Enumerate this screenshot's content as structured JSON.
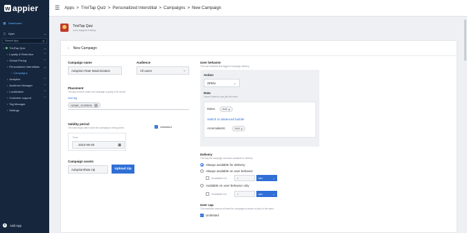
{
  "brand": {
    "logo_mark": "w",
    "logo_text": "appier"
  },
  "sidebar": {
    "dashboard": "Dashboard",
    "apps": "Apps",
    "search_placeholder": "Search App",
    "items": [
      {
        "label": "TriviTap Quiz"
      },
      {
        "label": "Loyalty & Retention"
      },
      {
        "label": "Global Pricing"
      },
      {
        "label": "Personalized Interstitials"
      },
      {
        "label": "Campaigns"
      },
      {
        "label": "Analytics"
      },
      {
        "label": "Audience Manager"
      },
      {
        "label": "Localization"
      },
      {
        "label": "Customer support"
      },
      {
        "label": "Tag Manager"
      },
      {
        "label": "Settings"
      }
    ],
    "add_app": "Add App"
  },
  "breadcrumb": [
    "Apps",
    ">",
    "TriviTap Quiz",
    ">",
    "Personalized Interstitial",
    ">",
    "Campaigns",
    ">",
    "New Campaign"
  ],
  "app": {
    "name": "TriviTap Quiz",
    "package": "com.wappier.trivitap"
  },
  "page": {
    "title": "New Campaign"
  },
  "form": {
    "campaign_name_label": "Campaign name",
    "campaign_name_value": "Adoption Rate Maximization",
    "audience_label": "Audience",
    "audience_value": "All users",
    "placement_label": "Placement",
    "placement_hint": "The app screens where the campaign is going to be shown.",
    "add_tag": "Add tag",
    "placement_chip": "HOME_SCREEN",
    "validity_label": "Validity period",
    "validity_hint": "The date range within which the campaign is being active.",
    "unlimited": "Unlimited",
    "from_label": "From",
    "from_value": "2022-09-29",
    "assets_label": "Campaign assets",
    "assets_value": "AdoptionRate.zip",
    "upload_button": "Upload zip"
  },
  "user_behavior": {
    "label": "User behavior",
    "hint": "The user behavior that triggers Campaign delivery.",
    "action_label": "Action",
    "action_value": "OPEN",
    "data_label": "Data",
    "data_hint": "Leave it blank to use just the event.",
    "rules_label": "Rules:",
    "rules_value": "Add",
    "switch_link": "Switch to advanced builder",
    "accumulators_label": "Accumulators:",
    "accumulators_value": "Add"
  },
  "delivery": {
    "label": "Delivery",
    "hint": "The way the campaign becomes available for delivery.",
    "options": [
      {
        "label": "Always available for delivery",
        "checked": true
      },
      {
        "label": "Always available on user behavior",
        "checked": false
      },
      {
        "label": "Available on user behavior only",
        "checked": false
      }
    ],
    "available_for": "Available for:",
    "number_value": "1",
    "unit": "sec"
  },
  "user_cap": {
    "label": "User cap",
    "hint": "The maximum amount of times the campaign is shown to each of the users.",
    "unlimited": "Unlimited"
  },
  "colors": {
    "sidebar": "#16263d",
    "accent": "#2f6fd6",
    "active": "#5fb6ff"
  }
}
